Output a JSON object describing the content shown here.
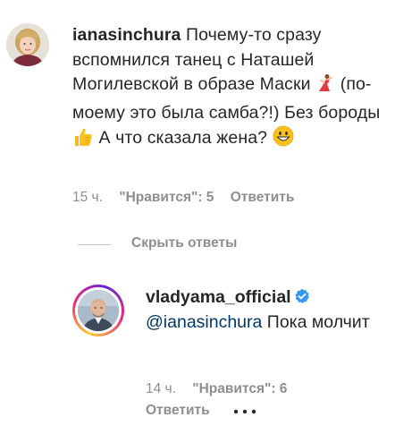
{
  "comment": {
    "username": "ianasinchura",
    "text_part1": "Почему-то сразу вспомнился танец с Наташей Могилевской в образе Маски",
    "text_part2": "(по-моему это была самба?!) Без бороды",
    "text_part3": "А что сказала жена?",
    "emoji_dancer": "dancer-emoji",
    "emoji_thumbs": "thumbs-up-emoji",
    "emoji_smile": "grinning-emoji",
    "time": "15 ч.",
    "likes": "\"Нравится\": 5",
    "reply_label": "Ответить"
  },
  "replies_toggle": {
    "label": "Скрыть ответы"
  },
  "reply": {
    "username": "vladyama_official",
    "verified_icon": "verified-badge-icon",
    "mention": "@ianasinchura",
    "text": "Пока молчит",
    "time": "14 ч.",
    "likes": "\"Нравится\": 6",
    "reply_label": "Ответить",
    "more_icon": "more-options-icon"
  },
  "colors": {
    "text": "#262626",
    "muted": "#8e8e8e",
    "mention": "#00376b",
    "verified": "#3897f0"
  }
}
